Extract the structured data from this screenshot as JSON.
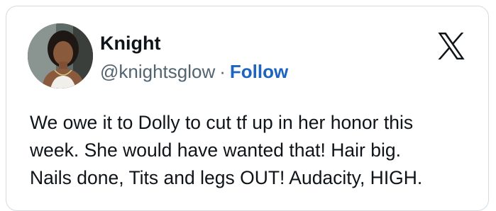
{
  "author": {
    "display_name": "Knight",
    "handle": "@knightsglow",
    "separator": "·",
    "follow_label": "Follow"
  },
  "tweet": {
    "lines": [
      "We owe it to Dolly to cut tf up in her honor this",
      "week. She would have wanted that! Hair big.",
      "Nails done, Tits and legs OUT! Audacity, HIGH."
    ]
  },
  "icons": {
    "platform_logo": "x-logo-icon"
  },
  "colors": {
    "follow": "#1d64c0",
    "secondary_text": "#536471",
    "border": "#d3dbe1"
  }
}
